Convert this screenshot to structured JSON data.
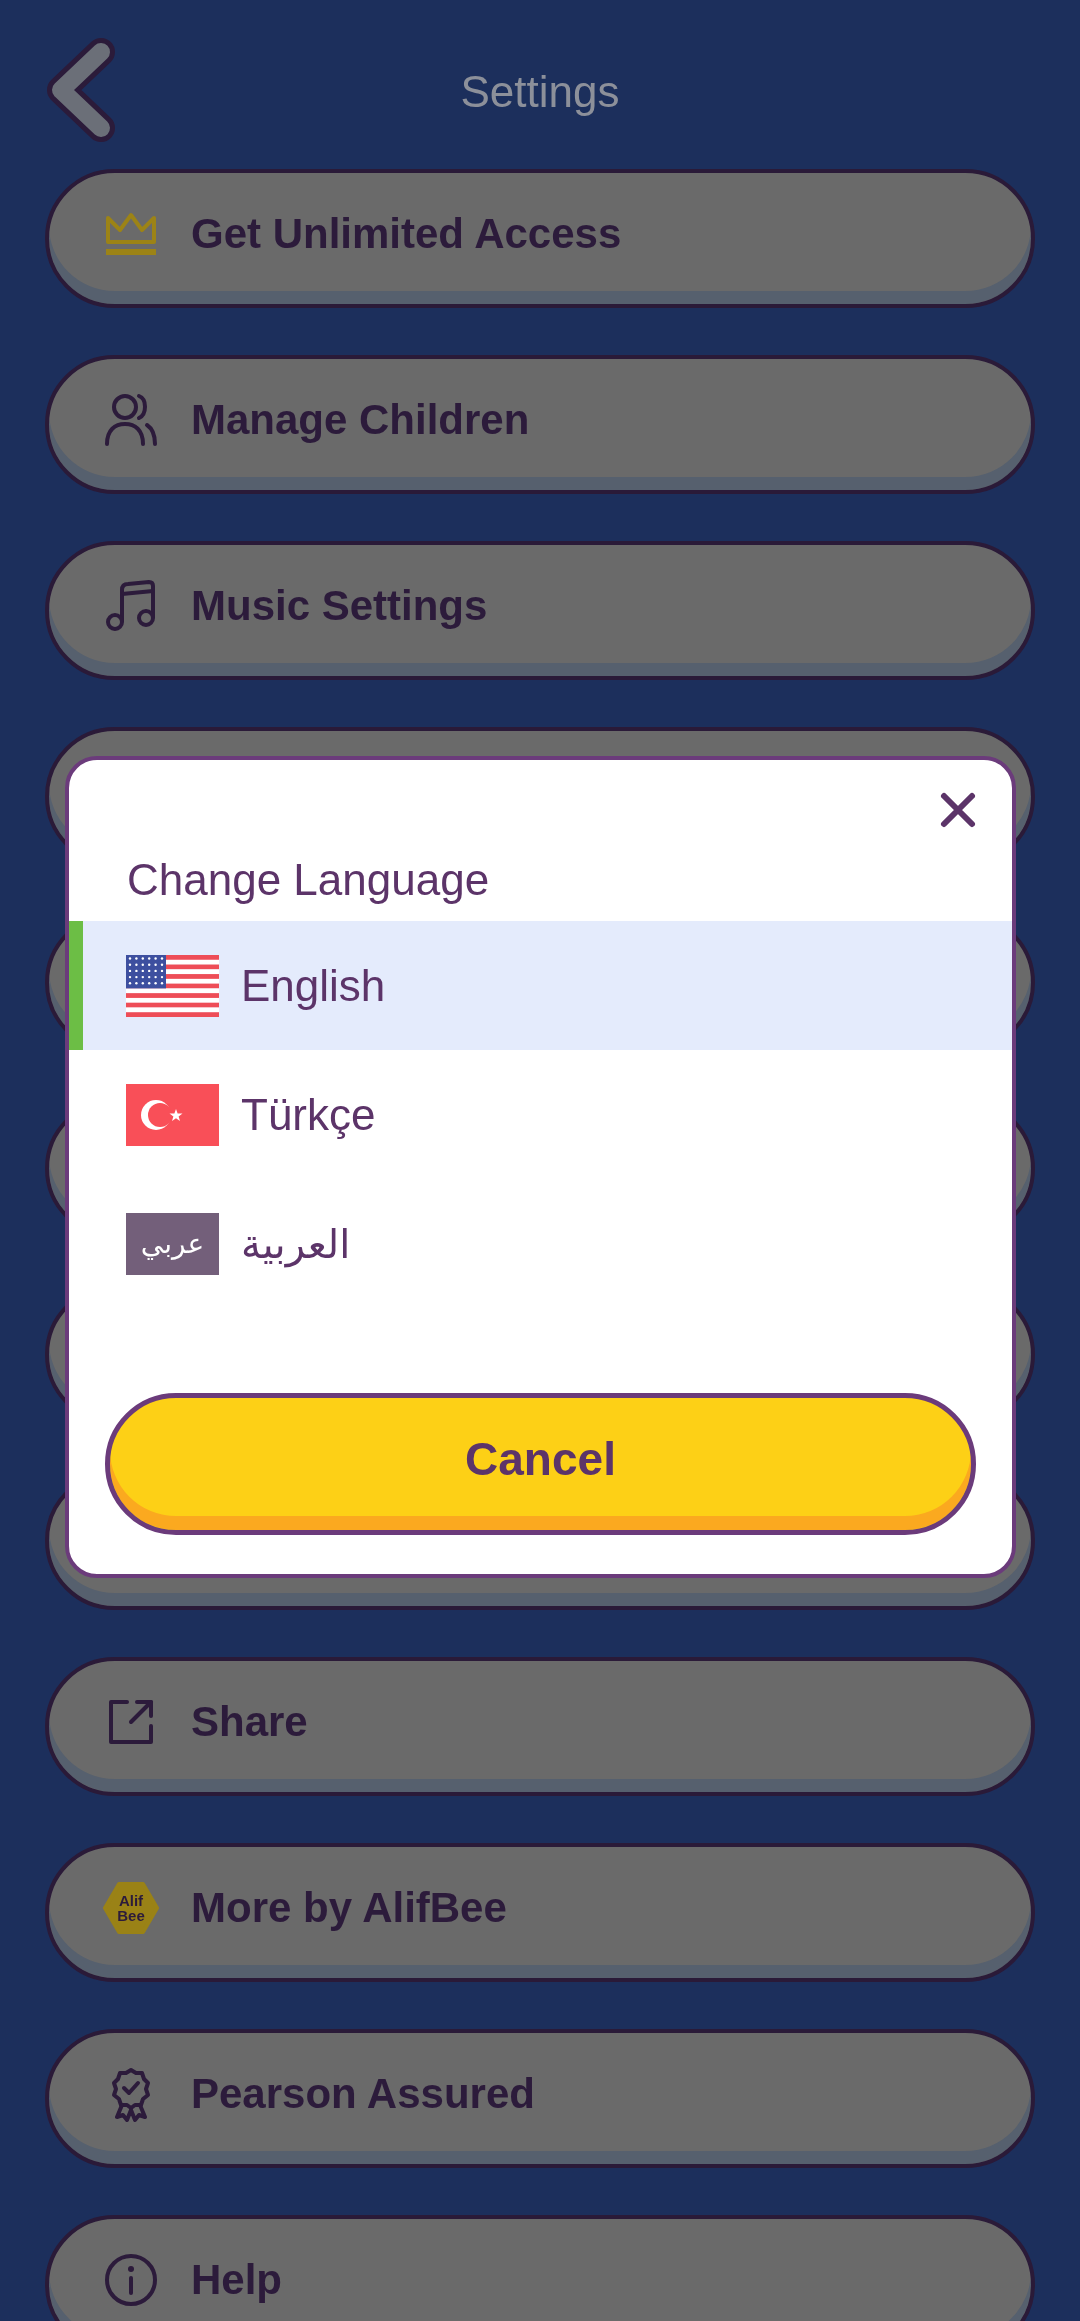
{
  "header": {
    "title": "Settings"
  },
  "menu_items": [
    {
      "kind": "button",
      "label": "Get Unlimited Access"
    },
    {
      "kind": "button",
      "label": "Manage Children"
    },
    {
      "kind": "button",
      "label": "Music Settings"
    },
    {
      "kind": "covered"
    },
    {
      "kind": "covered"
    },
    {
      "kind": "covered"
    },
    {
      "kind": "covered"
    },
    {
      "kind": "covered"
    },
    {
      "kind": "button",
      "label": "Share"
    },
    {
      "kind": "button",
      "label": "More by AlifBee",
      "logo_text": [
        "Alif",
        "Bee"
      ]
    },
    {
      "kind": "button",
      "label": "Pearson Assured"
    },
    {
      "kind": "button",
      "label": "Help"
    }
  ],
  "dialog": {
    "title": "Change Language",
    "languages": [
      {
        "label": "English",
        "selected": true
      },
      {
        "label": "Türkçe",
        "selected": false
      },
      {
        "label": "العربية",
        "flag_text": "عربي",
        "selected": false
      }
    ],
    "cancel_button": "Cancel"
  }
}
